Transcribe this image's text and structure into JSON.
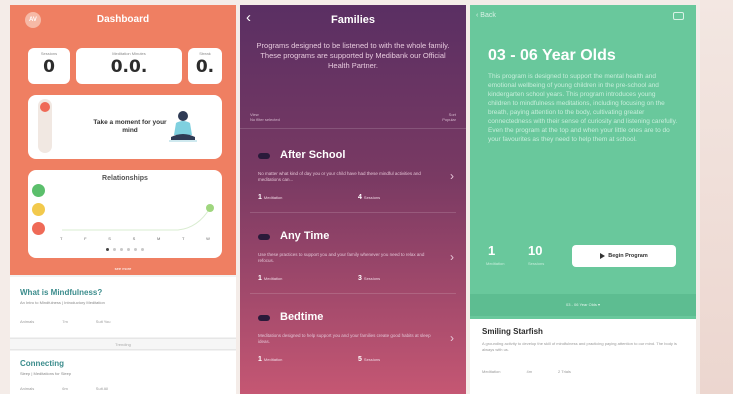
{
  "colors": {
    "dashboard_bg": "#ef7f62",
    "families_top": "#5a2f63",
    "families_bottom": "#c55773",
    "program_green": "#69c89c"
  },
  "dashboard": {
    "avatar": "AV",
    "title": "Dashboard",
    "stats": [
      {
        "label": "Sessions",
        "value": "0"
      },
      {
        "label": "Meditation Minutes",
        "value": "0.0."
      },
      {
        "label": "Streak",
        "value": "0."
      }
    ],
    "prompt": "Take a moment for your mind",
    "relationships_title": "Relationships",
    "days": [
      "T",
      "F",
      "S",
      "S",
      "M",
      "T",
      "W"
    ],
    "see_more": "see more",
    "card1": {
      "title": "What is Mindfulness?",
      "subtitle": "An Intro to Mindfulness | Introductory Meditation",
      "meta": [
        "Animals",
        "7m",
        "Suit You"
      ]
    },
    "trending": "Trending",
    "card2": {
      "title": "Connecting",
      "subtitle": "Sleep | Meditations for Sleep",
      "meta": [
        "Animals",
        "6m",
        "Suit All"
      ]
    }
  },
  "families": {
    "back_icon": "chevron-left-icon",
    "title": "Families",
    "description": "Programs designed to be listened to with the whole family. These programs are supported by Medibank our Official Health Partner.",
    "sort_left": "View\nNo filter selected",
    "sort_right": "Sort\nPopular",
    "programs": [
      {
        "title": "After School",
        "description": "No matter what kind of day you or your child have had these mindful activities and meditations can...",
        "meditations": "1",
        "meditations_label": "Meditation",
        "sessions": "4",
        "sessions_label": "Sessions"
      },
      {
        "title": "Any Time",
        "description": "Use these practices to support you and your family whenever you need to relax and refocus.",
        "meditations": "1",
        "meditations_label": "Meditation",
        "sessions": "3",
        "sessions_label": "Sessions"
      },
      {
        "title": "Bedtime",
        "description": "Meditations designed to help support you and your families create good habits at sleep ideas.",
        "meditations": "1",
        "meditations_label": "Meditation",
        "sessions": "5",
        "sessions_label": "Sessions"
      }
    ]
  },
  "program": {
    "back_label": "Back",
    "title": "03 - 06 Year Olds",
    "description": "This program is designed to support the mental health and emotional wellbeing of young children in the pre-school and kindergarten school years. This program introduces young children to mindfulness meditations, including focusing on the breath, paying attention to the body, cultivating greater connectedness with their sense of curiosity and listening carefully. Even the program at the top and when your little ones are to do your favourites as they need to help them at school.",
    "meditations": "1",
    "meditations_label": "Meditation",
    "sessions": "10",
    "sessions_label": "Sessions",
    "begin_label": "Begin Program",
    "filter_label": "03 - 06 Year Olds",
    "session": {
      "title": "Smiling Starfish",
      "description": "A grounding activity to develop the skill of mindfulness and practicing paying attention to our mind. The body is always with us.",
      "meta": [
        "Meditation",
        "4m",
        "2 Trials"
      ]
    }
  }
}
